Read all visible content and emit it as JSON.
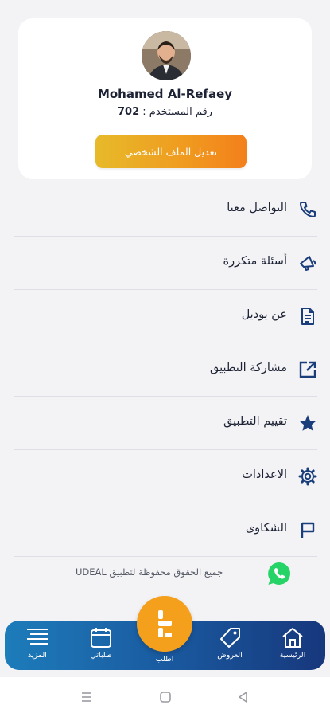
{
  "profile": {
    "name": "Mohamed Al-Refaey",
    "user_id_label": "رقم المستخدم :",
    "user_id_value": "702",
    "edit_button": "تعديل الملف الشخصي"
  },
  "menu": [
    {
      "label": "التواصل معنا",
      "icon": "phone-icon"
    },
    {
      "label": "أسئلة متكررة",
      "icon": "megaphone-icon"
    },
    {
      "label": "عن يوديل",
      "icon": "document-icon"
    },
    {
      "label": "مشاركة التطبيق",
      "icon": "share-icon"
    },
    {
      "label": "تقييم التطبيق",
      "icon": "star-icon"
    },
    {
      "label": "الاعدادات",
      "icon": "gear-icon"
    },
    {
      "label": "الشكاوى",
      "icon": "flag-icon"
    }
  ],
  "footer": {
    "copyright": "جميع الحقوق محفوظة لتطبيق UDEAL"
  },
  "bottom_nav": {
    "more": "المزيد",
    "requests": "طلباتي",
    "order": "اطلب",
    "offers": "العروض",
    "home": "الرئيسية"
  },
  "colors": {
    "accent": "#f4a01c",
    "nav_start": "#1d7cba",
    "nav_end": "#17377c",
    "text": "#1d2235",
    "whatsapp": "#25d366"
  }
}
